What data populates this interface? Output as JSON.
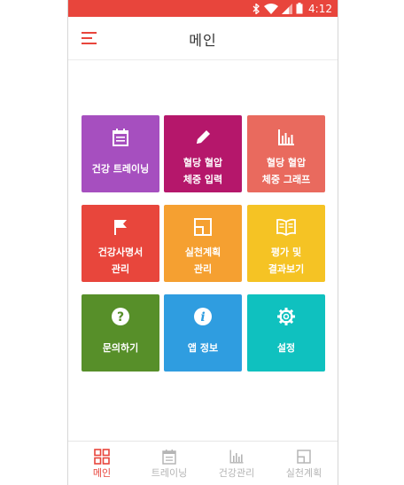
{
  "status_bar": {
    "time": "4:12",
    "icons": [
      "bluetooth-icon",
      "wifi-icon",
      "signal-icon",
      "battery-icon"
    ],
    "bg_color": "#e8453c"
  },
  "app_bar": {
    "title": "메인",
    "menu_icon": "hamburger-menu-icon",
    "accent_color": "#e8453c"
  },
  "tiles": [
    {
      "label": "건강 트레이닝",
      "icon": "calendar-icon",
      "color": "#a64fbf"
    },
    {
      "label": "혈당 혈압\n체중 입력",
      "icon": "pencil-icon",
      "color": "#b5176b"
    },
    {
      "label": "혈당 혈압\n체중 그래프",
      "icon": "bar-chart-icon",
      "color": "#e96a5e"
    },
    {
      "label": "건강사명서\n관리",
      "icon": "flag-icon",
      "color": "#e8463c"
    },
    {
      "label": "실천계획\n관리",
      "icon": "layout-icon",
      "color": "#f5a031"
    },
    {
      "label": "평가 및\n결과보기",
      "icon": "book-icon",
      "color": "#f5c324"
    },
    {
      "label": "문의하기",
      "icon": "question-icon",
      "color": "#578f29"
    },
    {
      "label": "앱 정보",
      "icon": "info-icon",
      "color": "#2f9de0"
    },
    {
      "label": "설정",
      "icon": "gear-icon",
      "color": "#0fc1bf"
    }
  ],
  "bottom_nav": [
    {
      "label": "메인",
      "icon": "grid-icon",
      "active": true
    },
    {
      "label": "트레이닝",
      "icon": "calendar-icon",
      "active": false
    },
    {
      "label": "건강관리",
      "icon": "bar-chart-icon",
      "active": false
    },
    {
      "label": "실천계획",
      "icon": "layout-icon",
      "active": false
    }
  ]
}
